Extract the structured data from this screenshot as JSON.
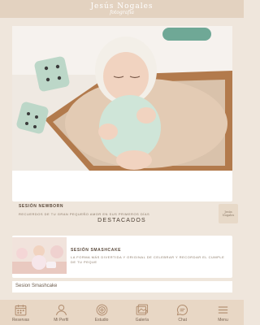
{
  "header": {
    "logo_name": "Jesús Nogales",
    "logo_sub": "fotografía"
  },
  "main_card": {
    "title": "SESIÓN NEWBORN",
    "subtitle": "RECUERDOS DE TU GRAN PEQUEÑO AMOR EN SUS PRIMEROS DÍAS",
    "mini_logo_line1": "Jesús",
    "mini_logo_line2": "Nogales"
  },
  "featured": {
    "section_title": "DESTACADOS",
    "item_title": "SESIÓN SMASHCAKE",
    "item_desc": "LA FORMA MÁS DIVERTIDA Y ORIGINAL DE CELEBRAR Y RECORDAR EL CUMPLE DE TU PEQUE",
    "caption": "Sesion Smashcake"
  },
  "nav": {
    "items": [
      {
        "label": "Reservas",
        "icon": "calendar-icon"
      },
      {
        "label": "Mi Perfil",
        "icon": "user-icon"
      },
      {
        "label": "Estudio",
        "icon": "badge-icon"
      },
      {
        "label": "Galería",
        "icon": "gallery-icon"
      },
      {
        "label": "Chat",
        "icon": "chat-icon"
      },
      {
        "label": "Menu",
        "icon": "menu-icon"
      }
    ]
  },
  "colors": {
    "accent": "#c9a98a",
    "background": "#efe6dc",
    "nav_bg": "#e8d7c5"
  }
}
